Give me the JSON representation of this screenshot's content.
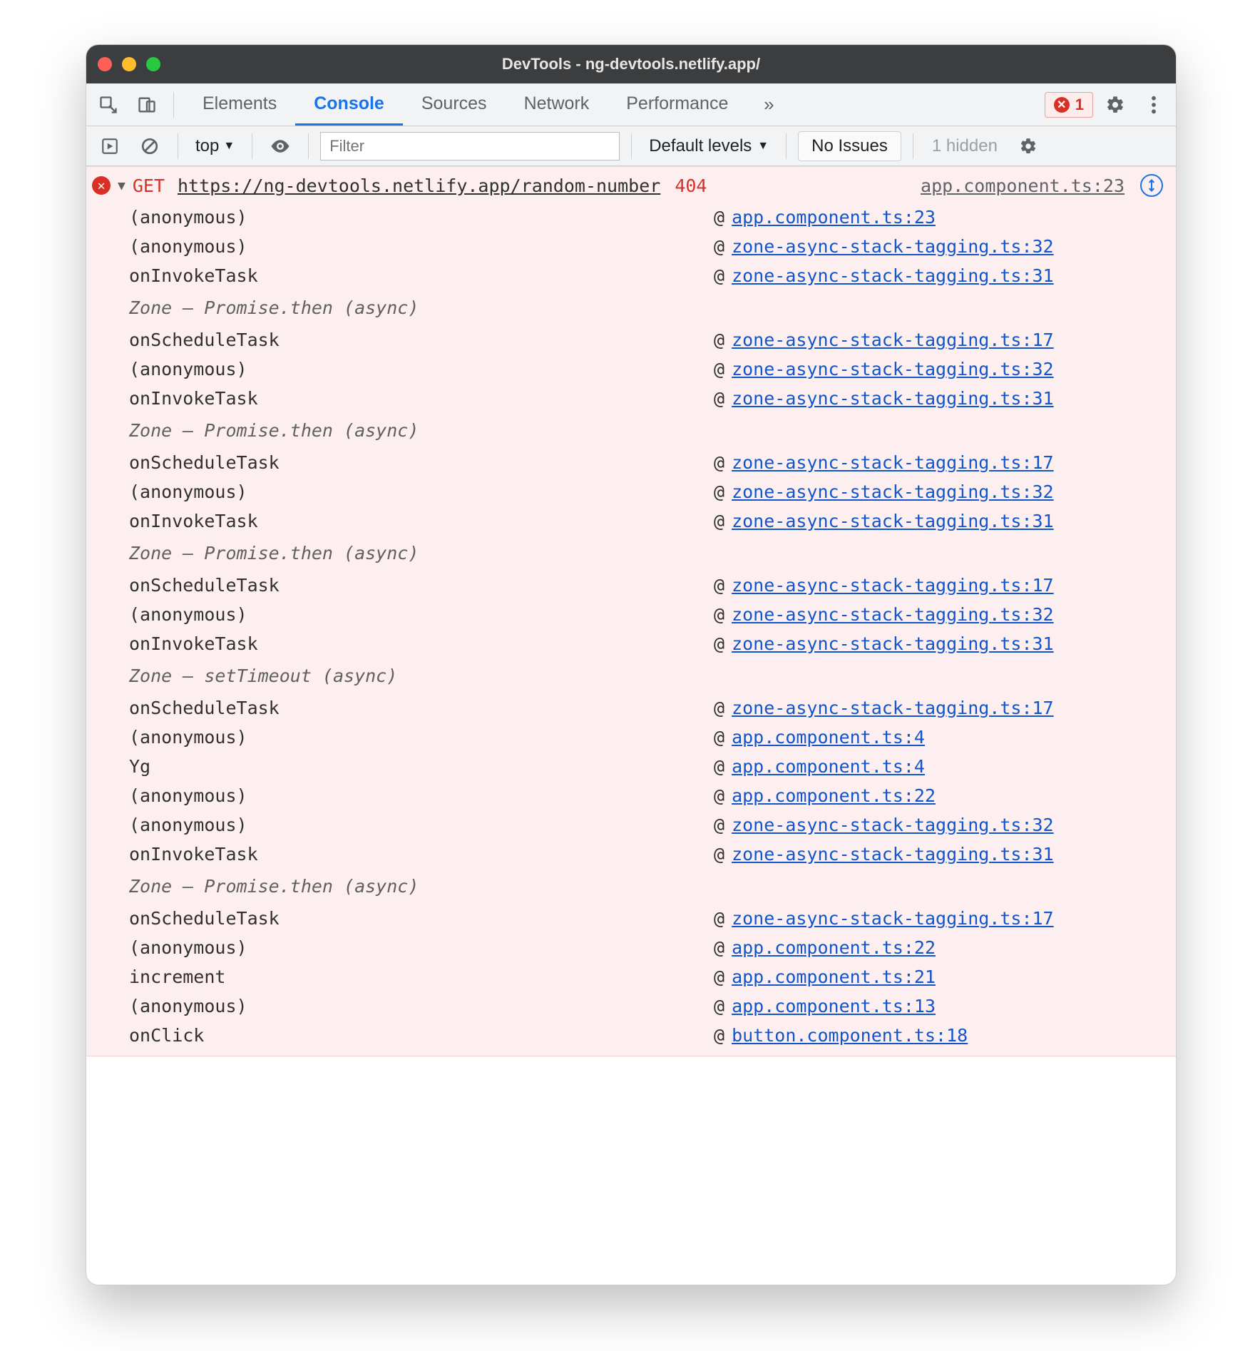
{
  "window": {
    "title": "DevTools - ng-devtools.netlify.app/"
  },
  "tabs": {
    "elements": "Elements",
    "console": "Console",
    "sources": "Sources",
    "network": "Network",
    "performance": "Performance"
  },
  "error_badge": {
    "count": "1"
  },
  "toolbar": {
    "frame": "top",
    "filter_placeholder": "Filter",
    "levels": "Default levels",
    "issues": "No Issues",
    "hidden": "1 hidden"
  },
  "error": {
    "method": "GET",
    "url": "https://ng-devtools.netlify.app/random-number",
    "status": "404",
    "source": "app.component.ts:23"
  },
  "groups": [
    {
      "type": "frames",
      "frames": [
        {
          "fn": "(anonymous)",
          "link": "app.component.ts:23"
        },
        {
          "fn": "(anonymous)",
          "link": "zone-async-stack-tagging.ts:32"
        },
        {
          "fn": "onInvokeTask",
          "link": "zone-async-stack-tagging.ts:31"
        }
      ]
    },
    {
      "type": "async",
      "label": "Zone — Promise.then (async)"
    },
    {
      "type": "frames",
      "frames": [
        {
          "fn": "onScheduleTask",
          "link": "zone-async-stack-tagging.ts:17"
        },
        {
          "fn": "(anonymous)",
          "link": "zone-async-stack-tagging.ts:32"
        },
        {
          "fn": "onInvokeTask",
          "link": "zone-async-stack-tagging.ts:31"
        }
      ]
    },
    {
      "type": "async",
      "label": "Zone — Promise.then (async)"
    },
    {
      "type": "frames",
      "frames": [
        {
          "fn": "onScheduleTask",
          "link": "zone-async-stack-tagging.ts:17"
        },
        {
          "fn": "(anonymous)",
          "link": "zone-async-stack-tagging.ts:32"
        },
        {
          "fn": "onInvokeTask",
          "link": "zone-async-stack-tagging.ts:31"
        }
      ]
    },
    {
      "type": "async",
      "label": "Zone — Promise.then (async)"
    },
    {
      "type": "frames",
      "frames": [
        {
          "fn": "onScheduleTask",
          "link": "zone-async-stack-tagging.ts:17"
        },
        {
          "fn": "(anonymous)",
          "link": "zone-async-stack-tagging.ts:32"
        },
        {
          "fn": "onInvokeTask",
          "link": "zone-async-stack-tagging.ts:31"
        }
      ]
    },
    {
      "type": "async",
      "label": "Zone — setTimeout (async)"
    },
    {
      "type": "frames",
      "frames": [
        {
          "fn": "onScheduleTask",
          "link": "zone-async-stack-tagging.ts:17"
        },
        {
          "fn": "(anonymous)",
          "link": "app.component.ts:4"
        },
        {
          "fn": "Yg",
          "link": "app.component.ts:4"
        },
        {
          "fn": "(anonymous)",
          "link": "app.component.ts:22"
        },
        {
          "fn": "(anonymous)",
          "link": "zone-async-stack-tagging.ts:32"
        },
        {
          "fn": "onInvokeTask",
          "link": "zone-async-stack-tagging.ts:31"
        }
      ]
    },
    {
      "type": "async",
      "label": "Zone — Promise.then (async)"
    },
    {
      "type": "frames",
      "frames": [
        {
          "fn": "onScheduleTask",
          "link": "zone-async-stack-tagging.ts:17"
        },
        {
          "fn": "(anonymous)",
          "link": "app.component.ts:22"
        },
        {
          "fn": "increment",
          "link": "app.component.ts:21"
        },
        {
          "fn": "(anonymous)",
          "link": "app.component.ts:13"
        },
        {
          "fn": "onClick",
          "link": "button.component.ts:18"
        }
      ]
    }
  ]
}
